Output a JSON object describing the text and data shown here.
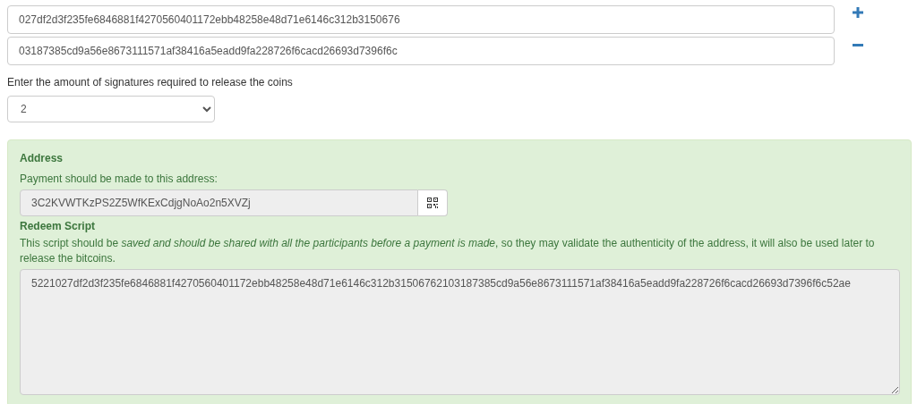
{
  "public_keys": [
    {
      "value": "027df2d3f235fe6846881f4270560401172ebb48258e48d71e6146c312b3150676"
    },
    {
      "value": "03187385cd9a56e8673111571af38416a5eadd9fa228726f6cacd26693d7396f6c"
    }
  ],
  "key_actions": [
    {
      "kind": "add"
    },
    {
      "kind": "remove"
    }
  ],
  "signatures": {
    "label": "Enter the amount of signatures required to release the coins",
    "value": "2"
  },
  "result": {
    "address_title": "Address",
    "address_hint": "Payment should be made to this address:",
    "address": "3C2KVWTKzPS2Z5WfKExCdjgNoAo2n5XVZj",
    "script_title": "Redeem Script",
    "script_hint": "This script should be *saved and should be shared with all the participants before a payment is made*, so they may validate the authenticity of the address, it will also be used later to release the bitcoins.",
    "script": "5221027df2d3f235fe6846881f4270560401172ebb48258e48d71e6146c312b31506762103187385cd9a56e8673111571af38416a5eadd9fa228726f6cacd26693d7396f6c52ae"
  }
}
